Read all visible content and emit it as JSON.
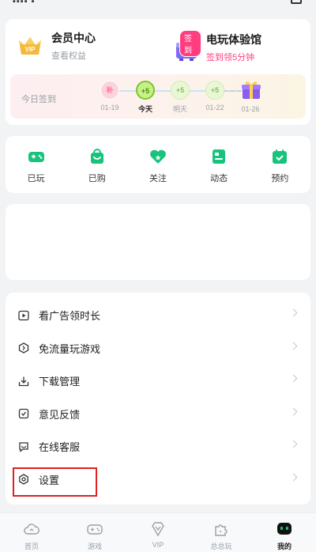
{
  "member_card": {
    "vip_badge_text": "VIP",
    "title": "会员中心",
    "subtitle": "查看权益",
    "promo_tag": "签到",
    "promo_title": "电玩体验馆",
    "promo_subtitle": "签到领5分钟"
  },
  "checkin": {
    "label": "今日签到",
    "days": [
      {
        "badge": "补",
        "label": "01-19"
      },
      {
        "badge": "+5",
        "label": "今天"
      },
      {
        "badge": "+5",
        "label": "明天"
      },
      {
        "badge": "+5",
        "label": "01-22"
      },
      {
        "badge": "",
        "label": "01-26"
      }
    ]
  },
  "actions": [
    {
      "label": "已玩",
      "icon": "gamepad-icon"
    },
    {
      "label": "已购",
      "icon": "shopping-bag-icon"
    },
    {
      "label": "关注",
      "icon": "heart-icon"
    },
    {
      "label": "动态",
      "icon": "feed-icon"
    },
    {
      "label": "预约",
      "icon": "calendar-check-icon"
    }
  ],
  "menu": [
    {
      "label": "看广告领时长",
      "icon": "play-ad-icon"
    },
    {
      "label": "免流量玩游戏",
      "icon": "free-data-icon"
    },
    {
      "label": "下载管理",
      "icon": "download-icon"
    },
    {
      "label": "意见反馈",
      "icon": "feedback-icon"
    },
    {
      "label": "在线客服",
      "icon": "chat-icon"
    },
    {
      "label": "设置",
      "icon": "settings-icon"
    }
  ],
  "bottom_nav": [
    {
      "label": "首页",
      "icon": "cloud-home-icon"
    },
    {
      "label": "游戏",
      "icon": "gamepad-icon"
    },
    {
      "label": "VIP",
      "icon": "vip-diamond-icon"
    },
    {
      "label": "总总玩",
      "icon": "puzzle-icon"
    },
    {
      "label": "我的",
      "icon": "profile-icon",
      "active": true
    }
  ],
  "colors": {
    "accent_green": "#19c37d",
    "promo_pink": "#ff3d7f",
    "highlight_red": "#e02020",
    "active_nav": "#111111"
  }
}
